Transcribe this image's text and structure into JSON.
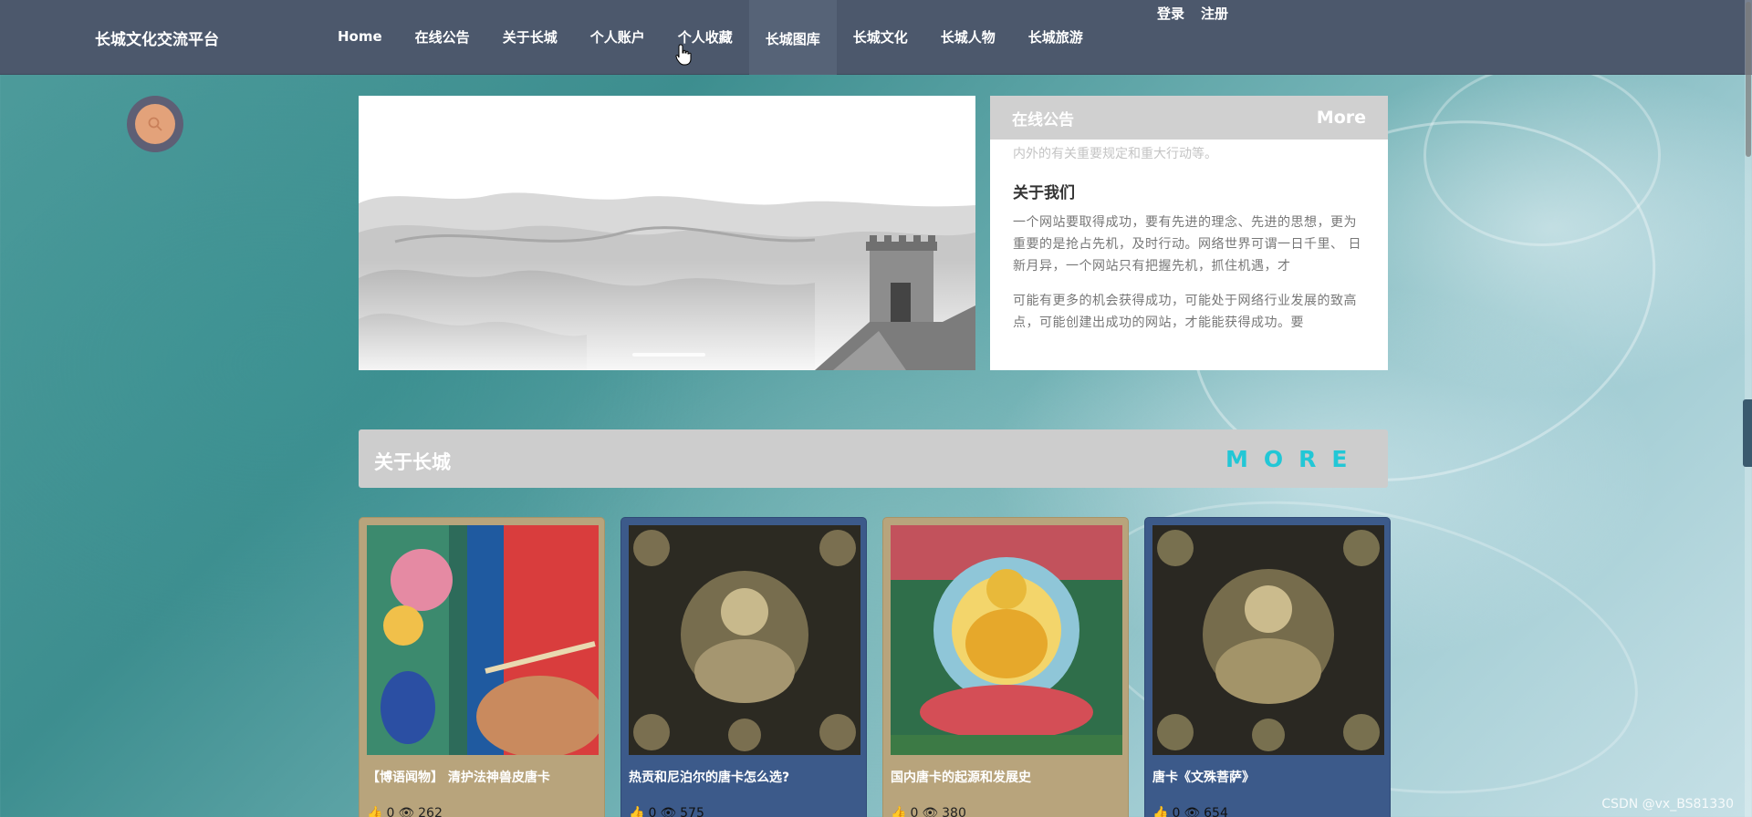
{
  "header": {
    "site_title": "长城文化交流平台",
    "nav": [
      "Home",
      "在线公告",
      "关于长城",
      "个人账户",
      "个人收藏",
      "长城图库",
      "长城文化",
      "长城人物",
      "长城旅游"
    ],
    "active_nav_index": 5,
    "login": "登录",
    "register": "注册"
  },
  "search": {
    "icon": "search-icon"
  },
  "notice": {
    "title": "在线公告",
    "more": "More",
    "faded_line": "内外的有关重要规定和重大行动等。",
    "about_heading": "关于我们",
    "para1": "一个网站要取得成功，要有先进的理念、先进的思想，更为重要的是抢占先机，及时行动。网络世界可谓一日千里、 日新月异，一个网站只有把握先机，抓住机遇，才",
    "para2": "可能有更多的机会获得成功，可能处于网络行业发展的致高点，可能创建出成功的网站，才能能获得成功。要"
  },
  "section": {
    "title": "关于长城",
    "more": "MORE"
  },
  "cards": [
    {
      "title": "【博语闻物】 清护法神兽皮唐卡",
      "likes": "0",
      "views": "262",
      "style": "tan"
    },
    {
      "title": "热贡和尼泊尔的唐卡怎么选?",
      "likes": "0",
      "views": "575",
      "style": "blue"
    },
    {
      "title": "国内唐卡的起源和发展史",
      "likes": "0",
      "views": "380",
      "style": "tan"
    },
    {
      "title": "唐卡《文殊菩萨》",
      "likes": "0",
      "views": "654",
      "style": "blue"
    }
  ],
  "colors": {
    "nav_bg": "#4c586c",
    "accent_more": "#22c7d6",
    "card_tan": "#b8a47c",
    "card_blue": "#3c5a8a"
  },
  "watermark": "CSDN @vx_BS81330"
}
